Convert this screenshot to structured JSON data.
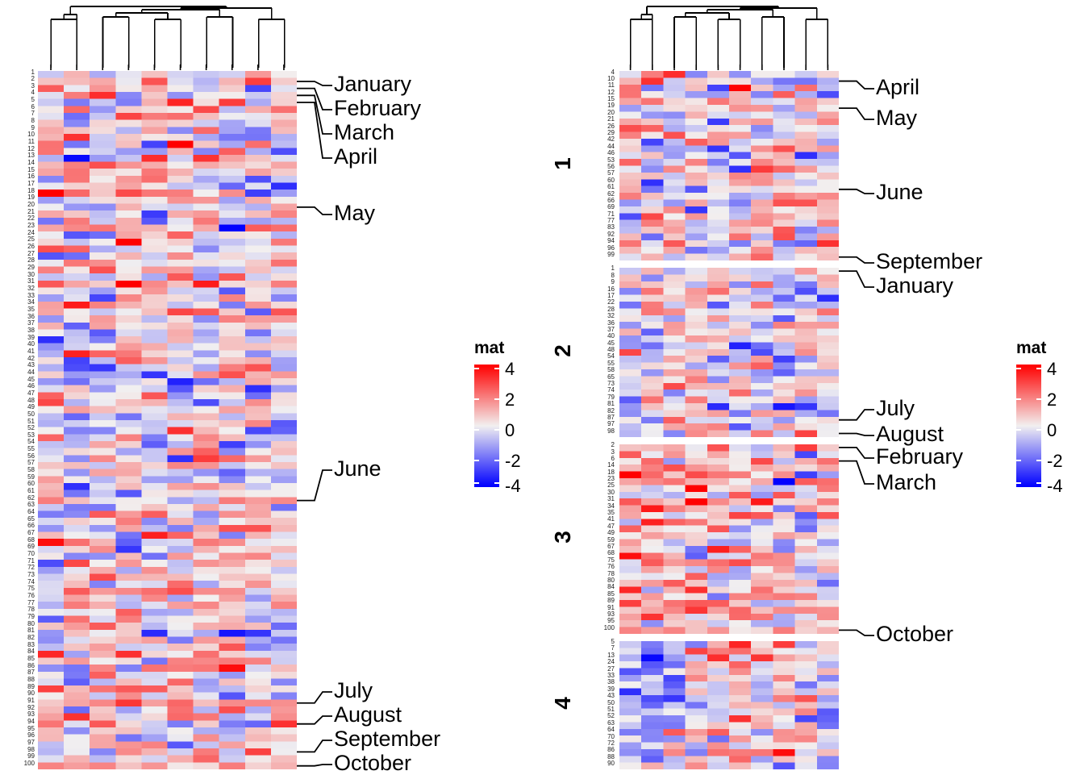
{
  "figure": {
    "type": "heatmap-pair-with-dendrogram",
    "title": "",
    "background": "#ffffff"
  },
  "legend": {
    "title": "mat",
    "ticks": [
      "4",
      "2",
      "0",
      "-2",
      "-4"
    ],
    "tick_values": [
      4,
      2,
      0,
      -2,
      -4
    ],
    "colors": {
      "high": "#ff0000",
      "mid": "#f2f0f0",
      "low": "#0000ff"
    },
    "range": [
      -4,
      4
    ]
  },
  "left_panel": {
    "name": "unsplit-heatmap",
    "n_rows": 100,
    "n_cols": 10,
    "row_labels": [
      "1",
      "2",
      "3",
      "4",
      "5",
      "6",
      "7",
      "8",
      "9",
      "10",
      "11",
      "12",
      "13",
      "14",
      "15",
      "16",
      "17",
      "18",
      "19",
      "20",
      "21",
      "22",
      "23",
      "24",
      "25",
      "26",
      "27",
      "28",
      "29",
      "30",
      "31",
      "32",
      "33",
      "34",
      "35",
      "36",
      "37",
      "38",
      "39",
      "40",
      "41",
      "42",
      "43",
      "44",
      "45",
      "46",
      "47",
      "48",
      "49",
      "50",
      "51",
      "52",
      "53",
      "54",
      "55",
      "56",
      "57",
      "58",
      "59",
      "60",
      "61",
      "62",
      "63",
      "64",
      "65",
      "66",
      "67",
      "68",
      "69",
      "70",
      "71",
      "72",
      "73",
      "74",
      "75",
      "76",
      "77",
      "78",
      "79",
      "80",
      "81",
      "82",
      "83",
      "84",
      "85",
      "86",
      "87",
      "88",
      "89",
      "90",
      "91",
      "92",
      "93",
      "94",
      "95",
      "96",
      "97",
      "98",
      "99",
      "100"
    ],
    "annotations": [
      {
        "label": "January",
        "row_index": 1
      },
      {
        "label": "February",
        "row_index": 2
      },
      {
        "label": "March",
        "row_index": 3
      },
      {
        "label": "April",
        "row_index": 4
      },
      {
        "label": "May",
        "row_index": 19
      },
      {
        "label": "June",
        "row_index": 61
      },
      {
        "label": "July",
        "row_index": 90
      },
      {
        "label": "August",
        "row_index": 93
      },
      {
        "label": "September",
        "row_index": 97
      },
      {
        "label": "October",
        "row_index": 99
      }
    ]
  },
  "right_panel": {
    "name": "kmeans-split-heatmap",
    "n_cols": 10,
    "cluster_labels": [
      "1",
      "2",
      "3",
      "4"
    ],
    "clusters": [
      {
        "label": "1",
        "row_labels": [
          "4",
          "10",
          "11",
          "12",
          "15",
          "19",
          "20",
          "21",
          "26",
          "29",
          "42",
          "44",
          "46",
          "53",
          "56",
          "57",
          "60",
          "61",
          "62",
          "66",
          "69",
          "71",
          "77",
          "83",
          "92",
          "94",
          "96",
          "99"
        ]
      },
      {
        "label": "2",
        "row_labels": [
          "1",
          "8",
          "9",
          "16",
          "17",
          "22",
          "28",
          "32",
          "36",
          "37",
          "40",
          "45",
          "48",
          "54",
          "55",
          "58",
          "65",
          "73",
          "74",
          "79",
          "81",
          "82",
          "87",
          "97",
          "98"
        ]
      },
      {
        "label": "3",
        "row_labels": [
          "2",
          "3",
          "6",
          "14",
          "18",
          "23",
          "25",
          "30",
          "31",
          "34",
          "35",
          "41",
          "47",
          "49",
          "59",
          "67",
          "68",
          "75",
          "76",
          "78",
          "80",
          "84",
          "85",
          "89",
          "91",
          "93",
          "95",
          "100"
        ]
      },
      {
        "label": "4",
        "row_labels": [
          "5",
          "7",
          "13",
          "24",
          "27",
          "33",
          "38",
          "39",
          "43",
          "50",
          "51",
          "52",
          "63",
          "64",
          "70",
          "72",
          "86",
          "88",
          "90"
        ]
      }
    ],
    "annotations": [
      {
        "label": "April",
        "cluster": 1,
        "row_index": 1
      },
      {
        "label": "May",
        "cluster": 1,
        "row_index": 5
      },
      {
        "label": "June",
        "cluster": 1,
        "row_index": 17
      },
      {
        "label": "September",
        "cluster": 1,
        "row_index": 27
      },
      {
        "label": "January",
        "cluster": 2,
        "row_index": 0
      },
      {
        "label": "July",
        "cluster": 2,
        "row_index": 22
      },
      {
        "label": "August",
        "cluster": 2,
        "row_index": 24
      },
      {
        "label": "February",
        "cluster": 3,
        "row_index": 0
      },
      {
        "label": "March",
        "cluster": 3,
        "row_index": 2
      },
      {
        "label": "October",
        "cluster": 3,
        "row_index": 27
      }
    ]
  },
  "chart_data": {
    "type": "heatmap",
    "title": "",
    "xlabel": "",
    "ylabel": "",
    "legend_title": "mat",
    "colorscale": [
      "#0000ff",
      "#f2f0f0",
      "#ff0000"
    ],
    "zlim": [
      -4,
      4
    ],
    "legend_ticks": [
      4,
      2,
      0,
      -2,
      -4
    ],
    "n_rows": 100,
    "n_cols": 10,
    "column_dendrogram": {
      "n_leaves": 10,
      "merges": [
        [
          0,
          1
        ],
        [
          2,
          3
        ],
        [
          4,
          5
        ],
        [
          6,
          7
        ],
        [
          8,
          9
        ]
      ],
      "description": "hierarchical clustering of 10 columns, 5 basal pairs joined into a nested topology"
    },
    "row_split": {
      "method": "kmeans",
      "k": 4,
      "cluster_sizes": [
        28,
        25,
        28,
        19
      ]
    }
  }
}
